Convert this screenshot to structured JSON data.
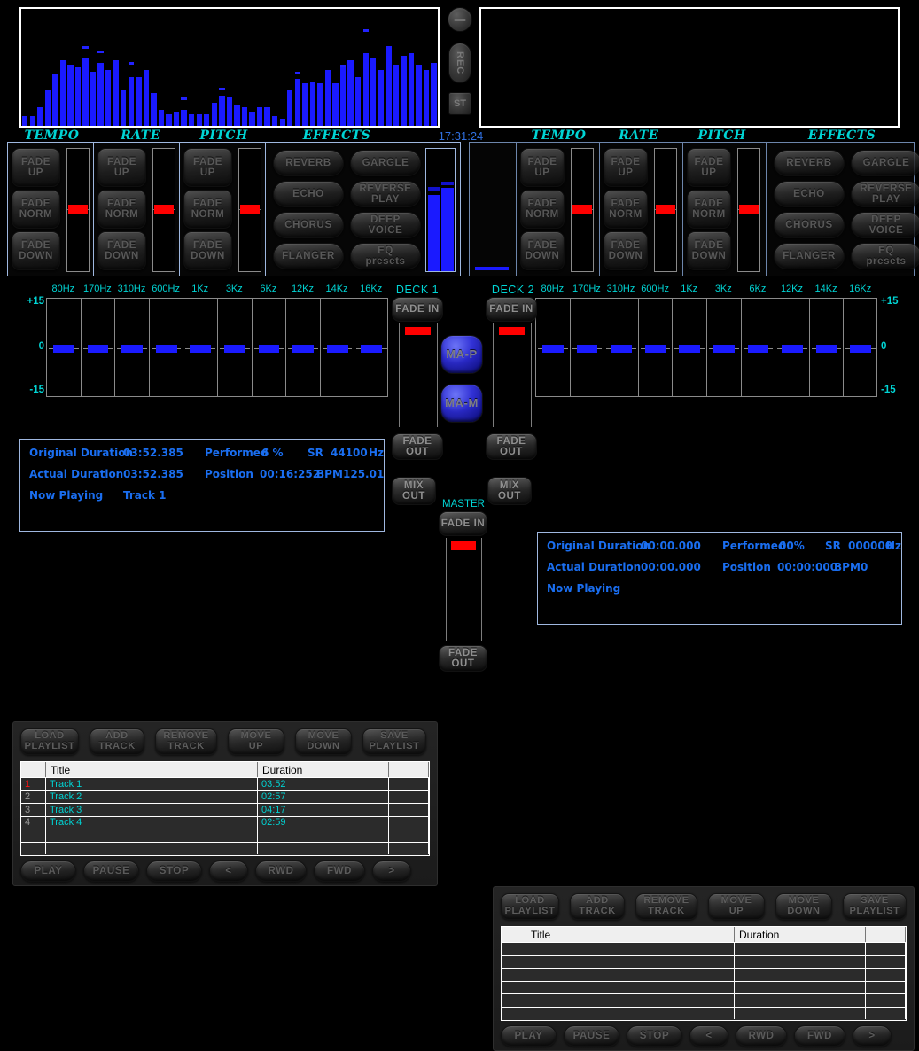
{
  "clock": "17:31:24",
  "top_controls": {
    "knob_name": "master-knob",
    "rec_label": "REC",
    "st_label": "ST"
  },
  "spectrum": {
    "left": {
      "bars": [
        8,
        8,
        16,
        30,
        45,
        56,
        52,
        50,
        58,
        46,
        54,
        48,
        56,
        30,
        42,
        42,
        48,
        28,
        14,
        10,
        12,
        14,
        10,
        10,
        10,
        20,
        26,
        24,
        18,
        16,
        12,
        16,
        16,
        8,
        6,
        30,
        40,
        36,
        38,
        36,
        48,
        36,
        52,
        56,
        42,
        62,
        58,
        48,
        68,
        52,
        60,
        62,
        52,
        48,
        54
      ],
      "peaks": [
        0,
        0,
        0,
        0,
        0,
        0,
        0,
        0,
        66,
        0,
        62,
        0,
        0,
        0,
        52,
        0,
        0,
        0,
        0,
        0,
        0,
        22,
        0,
        0,
        0,
        0,
        30,
        0,
        0,
        0,
        0,
        0,
        0,
        0,
        0,
        0,
        44,
        0,
        0,
        0,
        0,
        0,
        50,
        0,
        0,
        80,
        0,
        0,
        0,
        0,
        0,
        0,
        0,
        0,
        0
      ]
    },
    "right": {
      "bars": []
    }
  },
  "decks": [
    {
      "id": "deck-1",
      "name": "DECK 1",
      "sections": {
        "tempo": "TEMPO",
        "rate": "RATE",
        "pitch": "PITCH",
        "effects": "EFFECTS"
      },
      "fade_buttons": [
        "FADE UP",
        "FADE NORM",
        "FADE DOWN"
      ],
      "effects_buttons": [
        "REVERB",
        "GARGLE",
        "ECHO",
        "REVERSE PLAY",
        "CHORUS",
        "DEEP VOICE",
        "FLANGER",
        "EQ presets"
      ],
      "vu": {
        "left_level": 62,
        "right_level": 68,
        "left_peak": 66,
        "right_peak": 70
      },
      "eq": {
        "freq_labels": [
          "80Hz",
          "170Hz",
          "310Hz",
          "600Hz",
          "1Kz",
          "3Kz",
          "6Kz",
          "12Kz",
          "14Kz",
          "16Kz"
        ],
        "scale_top": "+15",
        "scale_mid": "0",
        "scale_bottom": "-15",
        "values": [
          0,
          0,
          0,
          0,
          0,
          0,
          0,
          0,
          0,
          0
        ]
      },
      "info": {
        "original_duration_label": "Original Duration",
        "original_duration_value": "03:52.385",
        "performed_label": "Performed",
        "performed_value": "6 %",
        "sr_label": "SR",
        "sr_value": "44100",
        "sr_unit": "Hz",
        "actual_duration_label": "Actual Duration",
        "actual_duration_value": "03:52.385",
        "position_label": "Position",
        "position_value": "00:16:252",
        "bpm_label": "BPM",
        "bpm_value": "125.01",
        "now_playing_label": "Now Playing",
        "now_playing_value": "Track 1"
      },
      "playlist": {
        "toolbar": [
          "LOAD PLAYLIST",
          "ADD TRACK",
          "REMOVE TRACK",
          "MOVE UP",
          "MOVE DOWN",
          "SAVE PLAYLIST"
        ],
        "headers": [
          "",
          "Title",
          "Duration",
          ""
        ],
        "rows": [
          {
            "idx": "1",
            "title": "Track 1",
            "duration": "03:52",
            "extra": "",
            "active": true
          },
          {
            "idx": "2",
            "title": "Track 2",
            "duration": "02:57",
            "extra": "",
            "active": false
          },
          {
            "idx": "3",
            "title": "Track 3",
            "duration": "04:17",
            "extra": "",
            "active": false
          },
          {
            "idx": "4",
            "title": "Track 4",
            "duration": "02:59",
            "extra": "",
            "active": false
          },
          {
            "idx": "",
            "title": "",
            "duration": "",
            "extra": "",
            "active": false
          },
          {
            "idx": "",
            "title": "",
            "duration": "",
            "extra": "",
            "active": false
          }
        ],
        "transport": [
          "PLAY",
          "PAUSE",
          "STOP",
          "<",
          "RWD",
          "FWD",
          ">"
        ]
      }
    },
    {
      "id": "deck-2",
      "name": "DECK 2",
      "sections": {
        "tempo": "TEMPO",
        "rate": "RATE",
        "pitch": "PITCH",
        "effects": "EFFECTS"
      },
      "fade_buttons": [
        "FADE UP",
        "FADE NORM",
        "FADE DOWN"
      ],
      "effects_buttons": [
        "REVERB",
        "GARGLE",
        "ECHO",
        "REVERSE PLAY",
        "CHORUS",
        "DEEP VOICE",
        "FLANGER",
        "EQ presets"
      ],
      "vu": {
        "left_level": 0,
        "right_level": 0,
        "left_peak": 0,
        "right_peak": 0
      },
      "eq": {
        "freq_labels": [
          "80Hz",
          "170Hz",
          "310Hz",
          "600Hz",
          "1Kz",
          "3Kz",
          "6Kz",
          "12Kz",
          "14Kz",
          "16Kz"
        ],
        "scale_top": "+15",
        "scale_mid": "0",
        "scale_bottom": "-15",
        "values": [
          0,
          0,
          0,
          0,
          0,
          0,
          0,
          0,
          0,
          0
        ]
      },
      "info": {
        "original_duration_label": "Original Duration",
        "original_duration_value": "00:00.000",
        "performed_label": "Performed",
        "performed_value": "00%",
        "sr_label": "SR",
        "sr_value": "000000",
        "sr_unit": "Hz",
        "actual_duration_label": "Actual Duration",
        "actual_duration_value": "00:00.000",
        "position_label": "Position",
        "position_value": "00:00:000",
        "bpm_label": "BPM",
        "bpm_value": "0",
        "now_playing_label": "Now Playing",
        "now_playing_value": ""
      },
      "playlist": {
        "toolbar": [
          "LOAD PLAYLIST",
          "ADD TRACK",
          "REMOVE TRACK",
          "MOVE UP",
          "MOVE DOWN",
          "SAVE PLAYLIST"
        ],
        "headers": [
          "",
          "Title",
          "Duration",
          ""
        ],
        "rows": [
          {
            "idx": "",
            "title": "",
            "duration": "",
            "extra": "",
            "active": false
          },
          {
            "idx": "",
            "title": "",
            "duration": "",
            "extra": "",
            "active": false
          },
          {
            "idx": "",
            "title": "",
            "duration": "",
            "extra": "",
            "active": false
          },
          {
            "idx": "",
            "title": "",
            "duration": "",
            "extra": "",
            "active": false
          },
          {
            "idx": "",
            "title": "",
            "duration": "",
            "extra": "",
            "active": false
          },
          {
            "idx": "",
            "title": "",
            "duration": "",
            "extra": "",
            "active": false
          }
        ],
        "transport": [
          "PLAY",
          "PAUSE",
          "STOP",
          "<",
          "RWD",
          "FWD",
          ">"
        ]
      }
    }
  ],
  "center": {
    "deck1_label": "DECK 1",
    "deck2_label": "DECK 2",
    "fade_in": "FADE IN",
    "fade_out": "FADE OUT",
    "mix_out": "MIX OUT",
    "ma_p": "MA-P",
    "ma_m": "MA-M",
    "master_label": "MASTER"
  },
  "colors": {
    "accent_cyan": "#00d4d4",
    "blue_bar": "#1a1aff",
    "info_blue": "#1a6ef0",
    "red_thumb": "#ff0000",
    "active_row": "#ff1111"
  }
}
